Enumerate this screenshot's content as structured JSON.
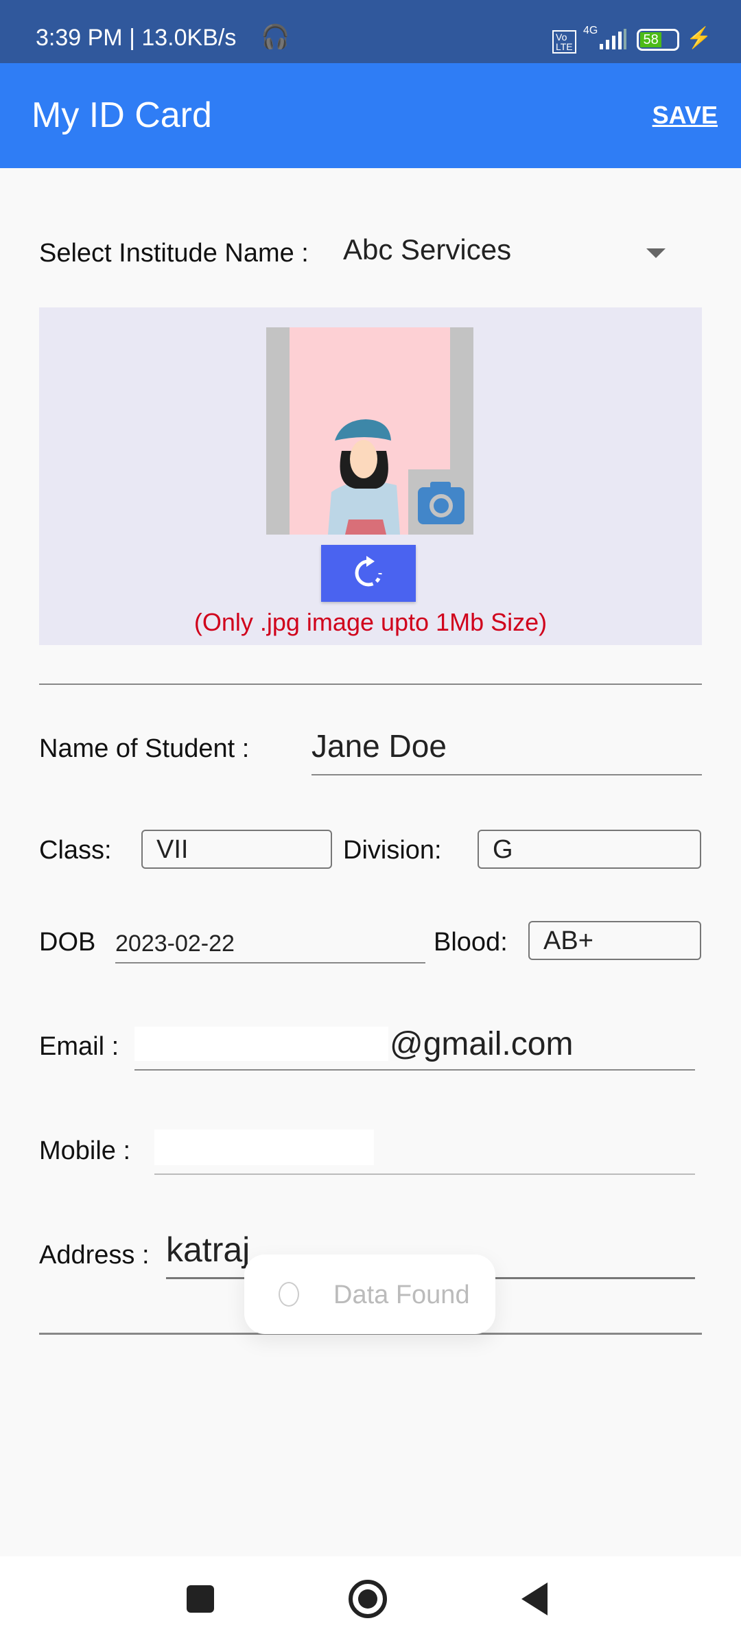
{
  "status_bar": {
    "time": "3:39 PM | 13.0KB/s",
    "battery": "58",
    "network": "4G"
  },
  "app_bar": {
    "title": "My ID Card",
    "save_label": "SAVE"
  },
  "institute": {
    "label": "Select Institude Name :",
    "value": "Abc Services"
  },
  "photo": {
    "note": "(Only .jpg image upto 1Mb Size)"
  },
  "form": {
    "name": {
      "label": "Name of Student :",
      "value": "Jane Doe"
    },
    "class": {
      "label": "Class:",
      "value": "VII"
    },
    "division": {
      "label": "Division:",
      "value": "G"
    },
    "dob": {
      "label": "DOB",
      "value": "2023-02-22"
    },
    "blood": {
      "label": "Blood:",
      "value": "AB+"
    },
    "email": {
      "label": "Email :",
      "value": "@gmail.com"
    },
    "mobile": {
      "label": "Mobile :",
      "value": ""
    },
    "address": {
      "label": "Address :",
      "value": "katraj"
    }
  },
  "toast": {
    "text": "Data Found"
  },
  "colors": {
    "accent": "#2f7df5",
    "status": "#30589c",
    "note": "#d0021b",
    "rotate": "#4a63f0"
  }
}
